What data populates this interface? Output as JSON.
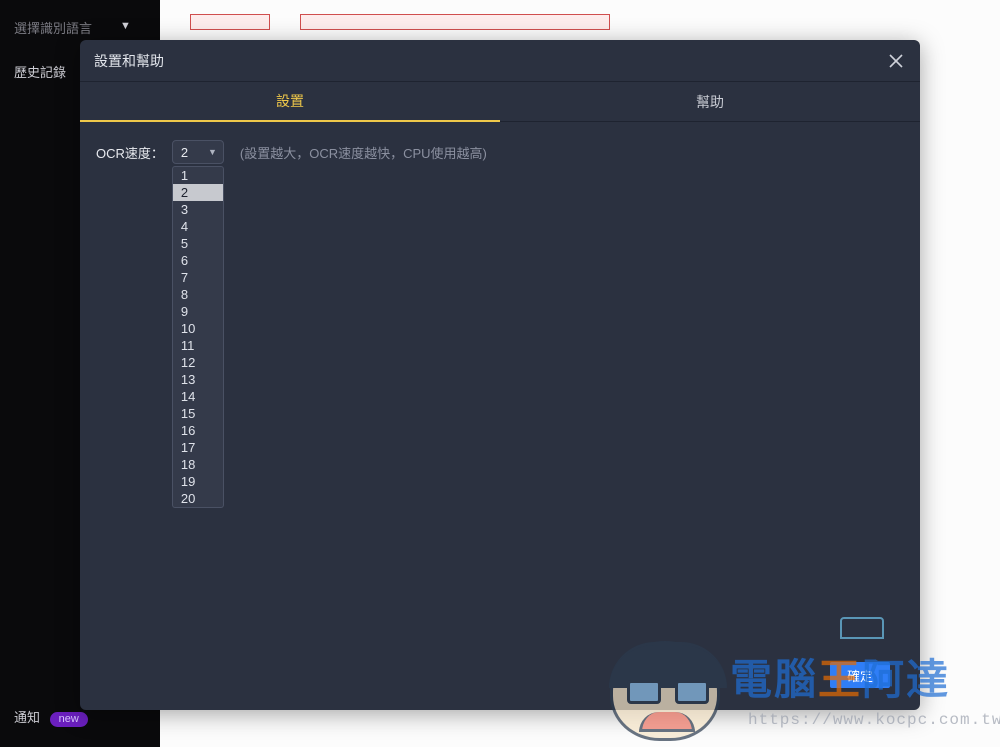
{
  "sidebar": {
    "lang_label": "選擇識別語言",
    "history_label": "歷史記錄",
    "notify_label": "通知",
    "new_badge": "new"
  },
  "modal": {
    "title": "設置和幫助",
    "tabs": {
      "settings": "設置",
      "help": "幫助"
    },
    "ocr_speed_label": "OCR速度：",
    "ocr_speed_value": "2",
    "ocr_speed_hint": "(設置越大，OCR速度越快，CPU使用越高)",
    "options": [
      "1",
      "2",
      "3",
      "4",
      "5",
      "6",
      "7",
      "8",
      "9",
      "10",
      "11",
      "12",
      "13",
      "14",
      "15",
      "16",
      "17",
      "18",
      "19",
      "20"
    ],
    "selected_option": "2",
    "confirm": "確定"
  },
  "watermark": {
    "logo_a": "電腦",
    "logo_b": "王",
    "logo_c": "阿達",
    "url": "https://www.kocpc.com.tw"
  }
}
